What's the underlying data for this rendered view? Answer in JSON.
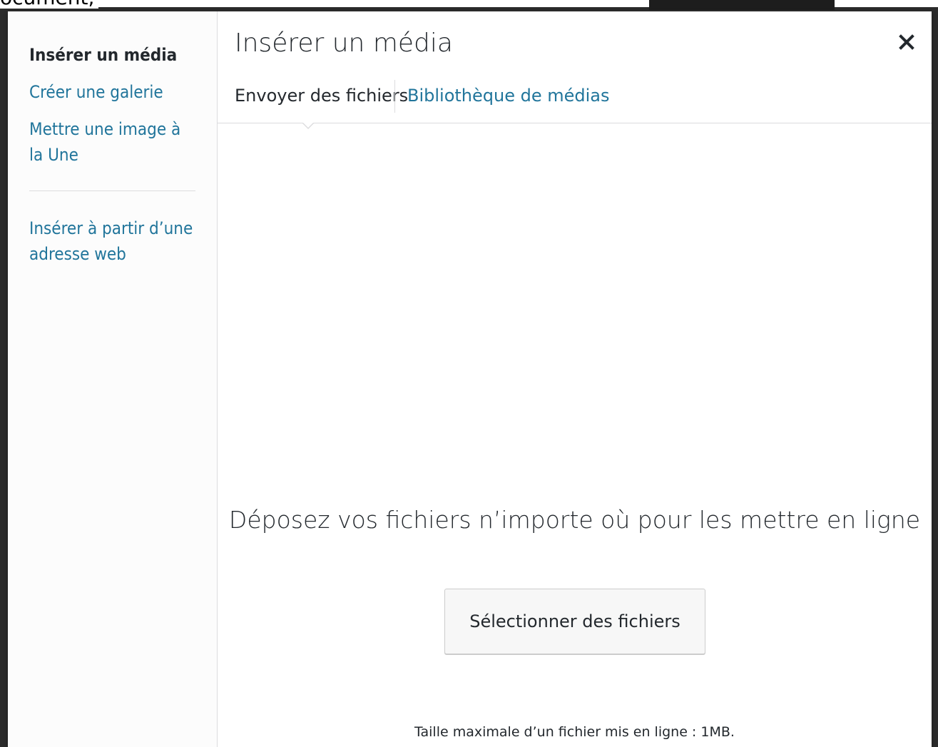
{
  "background": {
    "partial_text": "ocument,"
  },
  "menu": {
    "items": [
      {
        "label": "Insérer un média"
      },
      {
        "label": "Créer une galerie"
      },
      {
        "label": "Mettre une image à la Une"
      }
    ],
    "extra_items": [
      {
        "label": "Insérer à partir d’une adresse web"
      }
    ]
  },
  "frame": {
    "title": "Insérer un média",
    "close_icon": "close-icon"
  },
  "router": {
    "tabs": [
      {
        "label": "Envoyer des fichiers"
      },
      {
        "label": "Bibliothèque de médias"
      }
    ]
  },
  "uploader": {
    "drop_text": "Déposez vos fichiers n’importe où pour les mettre en ligne",
    "select_button": "Sélectionner des fichiers",
    "max_size": "Taille maximale d’un fichier mis en ligne : 1MB."
  },
  "colors": {
    "link": "#21759b",
    "text": "#23282d",
    "border": "#dcdcde"
  }
}
